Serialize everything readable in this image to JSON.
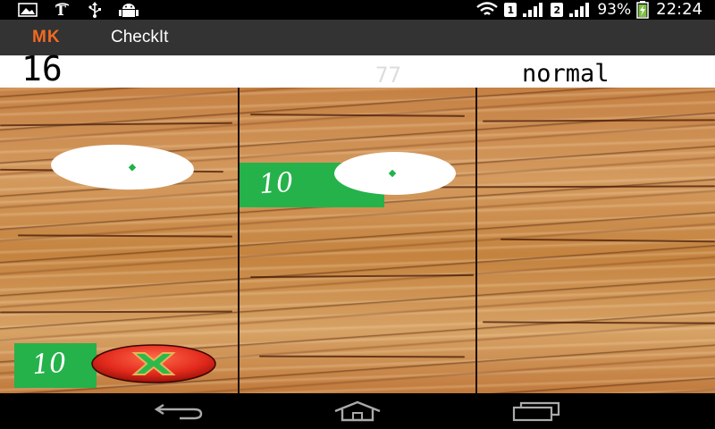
{
  "status_bar": {
    "battery_percent": "93%",
    "time": "22:24",
    "sim1_label": "1",
    "sim2_label": "2",
    "icons": {
      "left": [
        "gallery-icon",
        "nytimes-icon",
        "usb-icon",
        "android-debug-icon"
      ],
      "right": [
        "wifi-icon",
        "sim1-icon",
        "signal1-icon",
        "sim2-icon",
        "signal2-icon",
        "battery-charging-icon"
      ]
    }
  },
  "action_bar": {
    "logo": "MK",
    "title": "CheckIt"
  },
  "score_bar": {
    "score": "16",
    "counter": "77",
    "mode": "normal"
  },
  "board": {
    "tiles": [
      {
        "label": "10"
      },
      {
        "label": "10"
      }
    ],
    "close_button": {
      "icon": "close-x-icon"
    }
  },
  "nav_bar": {
    "icons": [
      "back-icon",
      "home-icon",
      "recent-apps-icon"
    ]
  },
  "colors": {
    "accent": "#f36a21",
    "tile_green": "#25b24a",
    "close_red": "#e2291c",
    "close_green": "#2eb84a",
    "action_bar": "#333333"
  }
}
